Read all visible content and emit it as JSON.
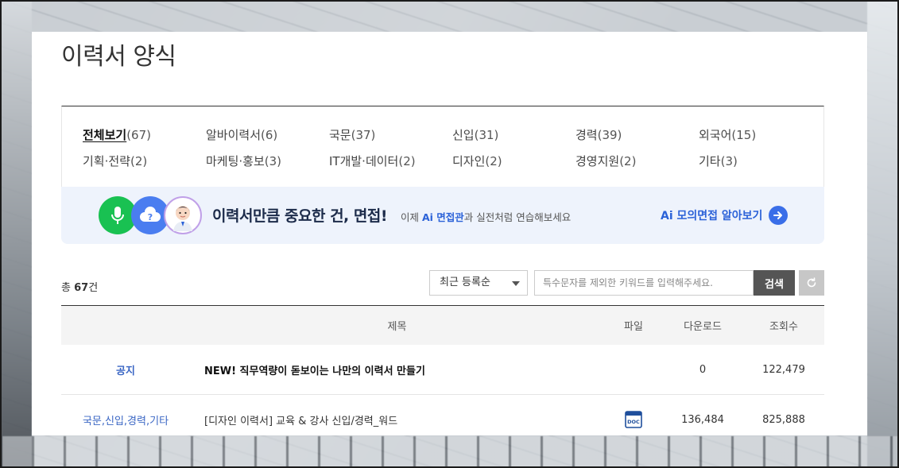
{
  "page": {
    "title": "이력서 양식"
  },
  "categories": [
    {
      "name": "전체보기",
      "count": "(67)",
      "active": true
    },
    {
      "name": "알바이력서",
      "count": "(6)"
    },
    {
      "name": "국문",
      "count": "(37)"
    },
    {
      "name": "신입",
      "count": "(31)"
    },
    {
      "name": "경력",
      "count": "(39)"
    },
    {
      "name": "외국어",
      "count": "(15)"
    },
    {
      "name": "기획·전략",
      "count": "(2)"
    },
    {
      "name": "마케팅·홍보",
      "count": "(3)"
    },
    {
      "name": "IT개발·데이터",
      "count": "(2)"
    },
    {
      "name": "디자인",
      "count": "(2)"
    },
    {
      "name": "경영지원",
      "count": "(2)"
    },
    {
      "name": "기타",
      "count": "(3)"
    }
  ],
  "banner": {
    "headline": "이력서만큼 중요한 건, 면접!",
    "sub_prefix": "이제 ",
    "sub_highlight": "Ai 면접관",
    "sub_suffix": "과 실전처럼 연습해보세요",
    "cta_part1": "Ai 모의면접",
    "cta_part2": " 알아보기",
    "icons": [
      "microphone-icon",
      "question-cloud-icon",
      "interviewer-avatar"
    ],
    "colors": {
      "mic": "#19c152",
      "help": "#4a7df0",
      "accent": "#2b62d8"
    }
  },
  "list_controls": {
    "total_prefix": "총 ",
    "total_count": "67",
    "total_suffix": "건",
    "sort_selected": "최근 등록순",
    "search_placeholder": "특수문자를 제외한 키워드를 입력해주세요.",
    "search_value": "",
    "search_button": "검색",
    "reset_icon": "refresh-icon"
  },
  "table": {
    "headers": {
      "category": "",
      "title": "제목",
      "file": "파일",
      "downloads": "다운로드",
      "views": "조회수"
    },
    "rows": [
      {
        "category": "공지",
        "title": "NEW! 직무역량이 돋보이는 나만의 이력서 만들기",
        "file": "",
        "downloads": "0",
        "views": "122,479"
      },
      {
        "category": "국문,신입,경력,기타",
        "title": "[디자인 이력서] 교육 & 강사 신입/경력_워드",
        "file": "DOC",
        "downloads": "136,484",
        "views": "825,888"
      }
    ]
  }
}
